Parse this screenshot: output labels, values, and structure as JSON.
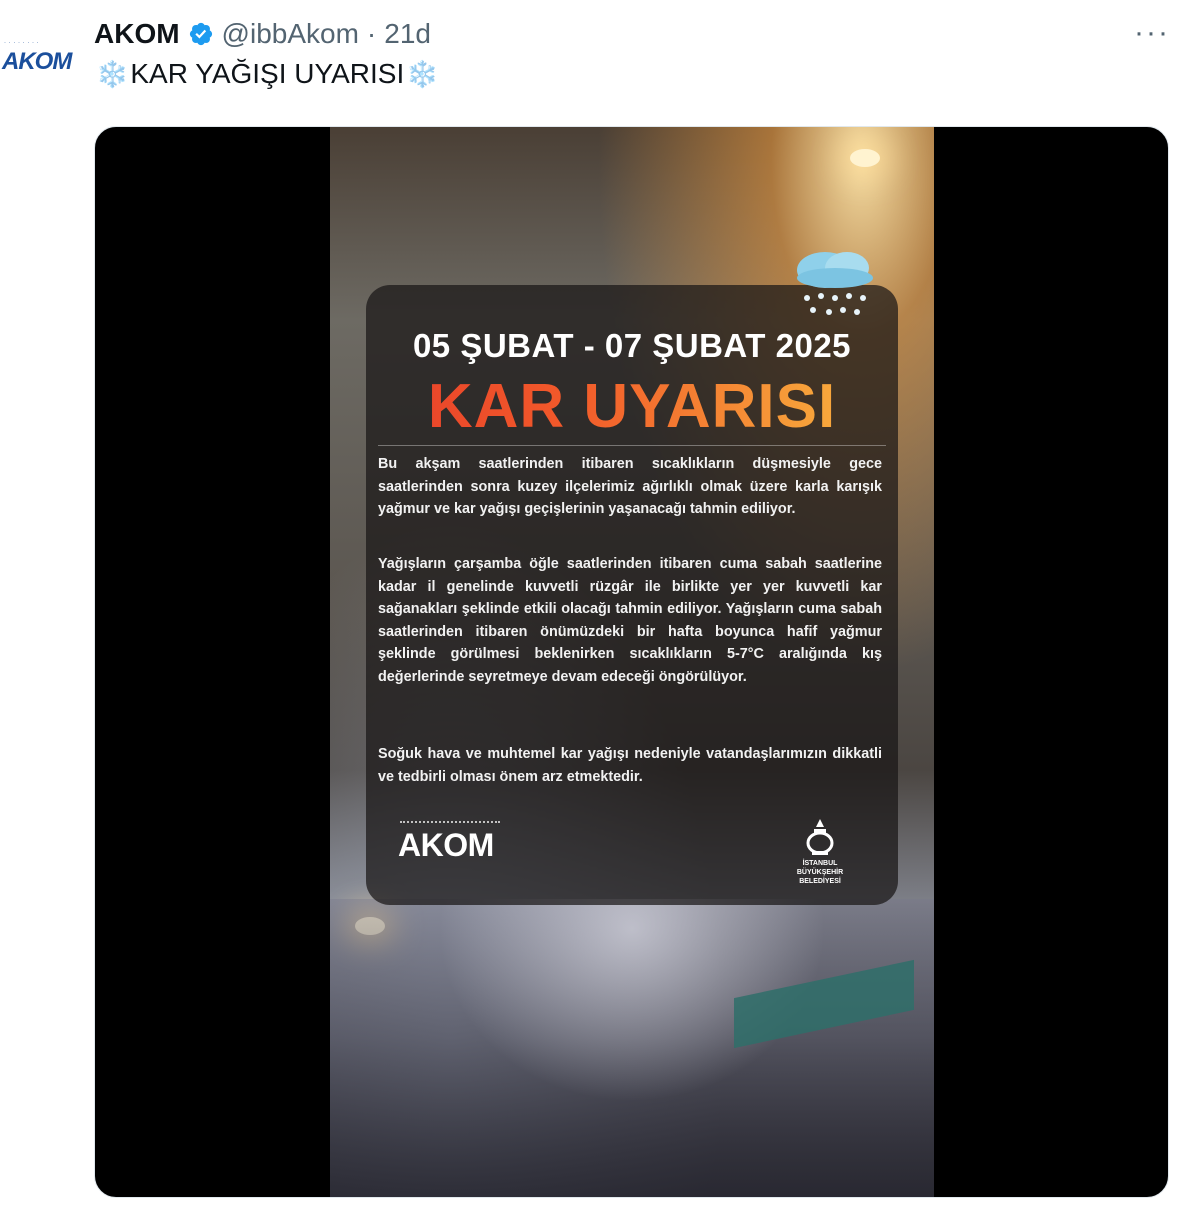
{
  "tweet": {
    "avatar_text": "AKOM",
    "author_name": "AKOM",
    "handle": "@ibbAkom",
    "separator": "·",
    "time": "21d",
    "more_label": "···",
    "snowflake": "❄️",
    "text": "KAR YAĞIŞI UYARISI"
  },
  "poster": {
    "date_range": "05 ŞUBAT - 07 ŞUBAT 2025",
    "title": "KAR UYARISI",
    "paragraph_1": "Bu akşam saatlerinden itibaren sıcaklıkların düşmesiyle gece saatlerinden sonra kuzey ilçelerimiz ağırlıklı olmak üzere karla karışık yağmur ve kar yağışı geçişlerinin yaşanacağı tahmin ediliyor.",
    "paragraph_2": "Yağışların çarşamba öğle saatlerinden itibaren cuma sabah saatlerine kadar il genelinde kuvvetli rüzgâr ile birlikte yer yer kuvvetli kar sağanakları şeklinde etkili olacağı tahmin ediliyor. Yağışların cuma sabah saatlerinden itibaren önümüzdeki bir hafta boyunca hafif yağmur şeklinde görülmesi beklenirken sıcaklıkların 5-7°C aralığında kış değerlerinde seyretmeye devam edeceği öngörülüyor.",
    "paragraph_3": "Soğuk hava ve muhtemel kar yağışı nedeniyle vatandaşlarımızın dikkatli ve tedbirli olması önem arz etmektedir.",
    "logo_left": "AKOM",
    "logo_right_text": "İSTANBUL BÜYÜKŞEHİR BELEDİYESİ"
  },
  "icons": {
    "verified": "verified-badge-icon",
    "more": "more-icon",
    "weather": "snow-cloud-icon"
  },
  "colors": {
    "verified_blue": "#1d9bf0",
    "secondary_text": "#536471",
    "title_gradient_start": "#e53b2b",
    "title_gradient_end": "#fbbf45"
  }
}
